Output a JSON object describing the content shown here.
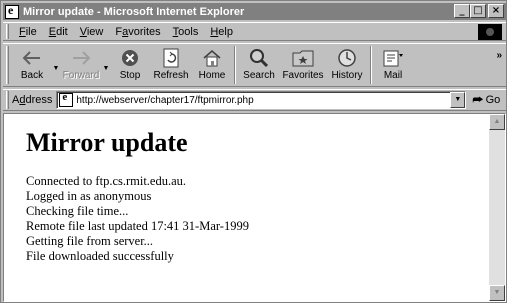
{
  "window": {
    "title": "Mirror update - Microsoft Internet Explorer",
    "controls": {
      "minimize": "_",
      "maximize": "□",
      "close": "×"
    }
  },
  "menu": {
    "items": [
      {
        "accel": "F",
        "rest": "ile"
      },
      {
        "accel": "E",
        "rest": "dit"
      },
      {
        "accel": "V",
        "rest": "iew"
      },
      {
        "pre": "F",
        "accel": "a",
        "rest": "vorites"
      },
      {
        "accel": "T",
        "rest": "ools"
      },
      {
        "accel": "H",
        "rest": "elp"
      }
    ]
  },
  "toolbar": {
    "back": "Back",
    "forward": "Forward",
    "stop": "Stop",
    "refresh": "Refresh",
    "home": "Home",
    "search": "Search",
    "favorites": "Favorites",
    "history": "History",
    "mail": "Mail",
    "more": "»"
  },
  "address": {
    "label_accel": "d",
    "label_pre": "A",
    "label_rest": "dress",
    "url": "http://webserver/chapter17/ftpmirror.php",
    "go": "Go"
  },
  "page": {
    "heading": "Mirror update",
    "lines": [
      "Connected to ftp.cs.rmit.edu.au.",
      "Logged in as anonymous",
      "Checking file time...",
      "Remote file last updated 17:41 31-Mar-1999",
      "Getting file from server...",
      "File downloaded successfully"
    ]
  }
}
